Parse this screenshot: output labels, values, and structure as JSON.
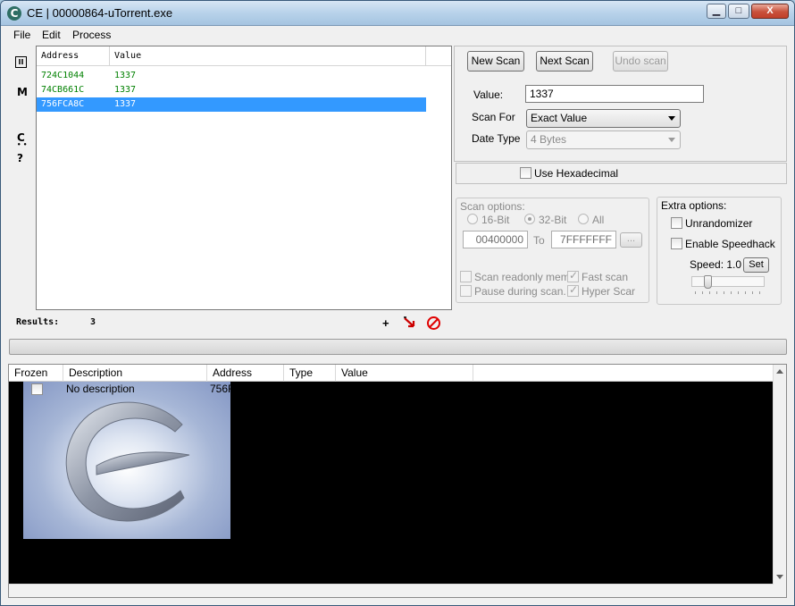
{
  "window": {
    "title": "CE | 00000864-uTorrent.exe",
    "icon_letter": "C",
    "controls": {
      "minimize": "▁",
      "maximize": "□",
      "close": "X"
    }
  },
  "menu": [
    "File",
    "Edit",
    "Process"
  ],
  "toolstrip": {
    "pause": "II",
    "memory": "M",
    "c": "C",
    "dots": "• •",
    "help": "?"
  },
  "results_list": {
    "columns": [
      "Address",
      "Value"
    ],
    "rows": [
      {
        "address": "724C1044",
        "value": "1337",
        "selected": false
      },
      {
        "address": "74CB661C",
        "value": "1337",
        "selected": false
      },
      {
        "address": "756FCA8C",
        "value": "1337",
        "selected": true
      }
    ]
  },
  "results": {
    "label": "Results:",
    "count": "3",
    "add_glyph": "+"
  },
  "scan": {
    "new_scan": "New Scan",
    "next_scan": "Next Scan",
    "undo_scan": "Undo scan",
    "value_label": "Value:",
    "value": "1337",
    "scan_for_label": "Scan For",
    "scan_for_value": "Exact Value",
    "data_type_label": "Date Type",
    "data_type_value": "4 Bytes",
    "use_hex_label": "Use Hexadecimal"
  },
  "scan_options": {
    "title": "Scan options:",
    "bit16": "16-Bit",
    "bit32": "32-Bit",
    "all": "All",
    "from": "00400000",
    "to_label": "To",
    "to": "7FFFFFFF",
    "browse": "...",
    "readonly": "Scan readonly mem.",
    "fast_scan": "Fast scan",
    "pause": "Pause during scan.",
    "hyper_scan": "Hyper Scar"
  },
  "extra_options": {
    "title": "Extra options:",
    "unrandomizer": "Unrandomizer",
    "speedhack": "Enable Speedhack",
    "speed_label": "Speed: 1.0",
    "set": "Set"
  },
  "address_list": {
    "columns": [
      "Frozen",
      "Description",
      "Address",
      "Type",
      "Value"
    ],
    "rows": [
      {
        "description": "No description",
        "address": "756F"
      }
    ]
  },
  "colors": {
    "selection": "#3399ff",
    "found_value": "#008000"
  }
}
